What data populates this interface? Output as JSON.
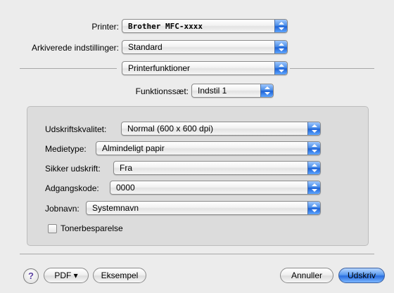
{
  "printer": {
    "label": "Printer:",
    "value": "Brother MFC-xxxx"
  },
  "presets": {
    "label": "Arkiverede indstillinger:",
    "value": "Standard"
  },
  "section": {
    "value": "Printerfunktioner"
  },
  "feature_set": {
    "label": "Funktionssæt:",
    "value": "Indstil 1"
  },
  "options": {
    "quality": {
      "label": "Udskriftskvalitet:",
      "value": "Normal (600 x 600 dpi)"
    },
    "media": {
      "label": "Medietype:",
      "value": "Almindeligt papir"
    },
    "secure": {
      "label": "Sikker udskrift:",
      "value": "Fra"
    },
    "password": {
      "label": "Adgangskode:",
      "value": "0000"
    },
    "jobname": {
      "label": "Jobnavn:",
      "value": "Systemnavn"
    },
    "toner": {
      "label": "Tonerbesparelse",
      "checked": false
    }
  },
  "buttons": {
    "help": "?",
    "pdf": "PDF ▾",
    "preview": "Eksempel",
    "cancel": "Annuller",
    "print": "Udskriv"
  },
  "colors": {
    "accent": "#2a6ee0",
    "background": "#ececec",
    "panel": "#dcdcdc"
  },
  "icons": {
    "popup_arrows": "up-down-arrows-icon",
    "help": "question-mark-icon"
  }
}
